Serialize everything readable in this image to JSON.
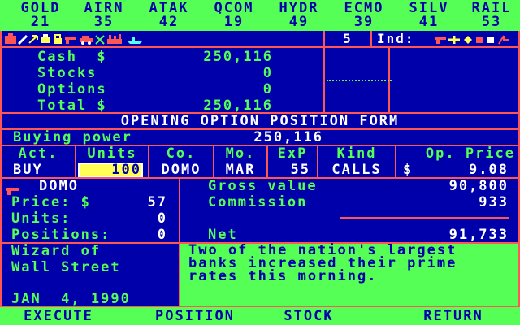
{
  "ticker": [
    {
      "sym": "GOLD",
      "price": "21"
    },
    {
      "sym": "AIRN",
      "price": "35"
    },
    {
      "sym": "ATAK",
      "price": "42"
    },
    {
      "sym": "QCOM",
      "price": "19"
    },
    {
      "sym": "HYDR",
      "price": "49"
    },
    {
      "sym": "ECMO",
      "price": "39"
    },
    {
      "sym": "SILV",
      "price": "41"
    },
    {
      "sym": "RAIL",
      "price": "53"
    }
  ],
  "toolbar": {
    "left_icons": [
      "briefcase-icon",
      "pencil-icon",
      "arrow-icon",
      "printer-icon",
      "lock-icon",
      "gun-icon",
      "car-icon",
      "tools-icon",
      "factory-icon",
      "ship-icon"
    ],
    "count": "5",
    "ind_label": "Ind:",
    "right_icons": [
      "gun-icon",
      "plane-icon",
      "diamond-icon",
      "square-icon",
      "box-icon",
      "bolt-icon"
    ]
  },
  "portfolio": {
    "cash_label": "Cash  $",
    "cash_value": "250,116",
    "stocks_label": "Stocks",
    "stocks_value": "0",
    "options_label": "Options",
    "options_value": "0",
    "total_label": "Total $",
    "total_value": "250,116"
  },
  "form": {
    "title": "OPENING OPTION POSITION FORM",
    "buying_power_label": "Buying power",
    "buying_power_value": "250,116",
    "headers": [
      "Act.",
      "Units",
      "Co.",
      "Mo.",
      "ExP",
      "Kind",
      "Op. Price"
    ],
    "action": "BUY",
    "units": "100",
    "company": "DOMO",
    "month": "MAR",
    "exercise_price": "55",
    "kind": "CALLS",
    "op_price_symbol": "$",
    "op_price": "9.08"
  },
  "stock_info": {
    "symbol": "DOMO",
    "price_label": "Price: $",
    "price": "57",
    "units_label": "Units:",
    "units": "0",
    "positions_label": "Positions:",
    "positions": "0"
  },
  "calc": {
    "gross_label": "Gross value",
    "gross_value": "90,800",
    "commission_label": "Commission",
    "commission_value": "933",
    "net_label": "Net",
    "net_value": "91,733"
  },
  "app": {
    "title_line1": "Wizard of",
    "title_line2": "Wall Street",
    "date": "JAN  4, 1990"
  },
  "news": "Two of the nation's largest banks increased their prime rates this morning.",
  "menu": [
    "EXECUTE",
    "POSITION",
    "STOCK",
    "RETURN"
  ],
  "colors": {
    "background": "#0000aa",
    "border": "#ff5555",
    "highlight": "#55ff55",
    "input": "#ffff55"
  }
}
